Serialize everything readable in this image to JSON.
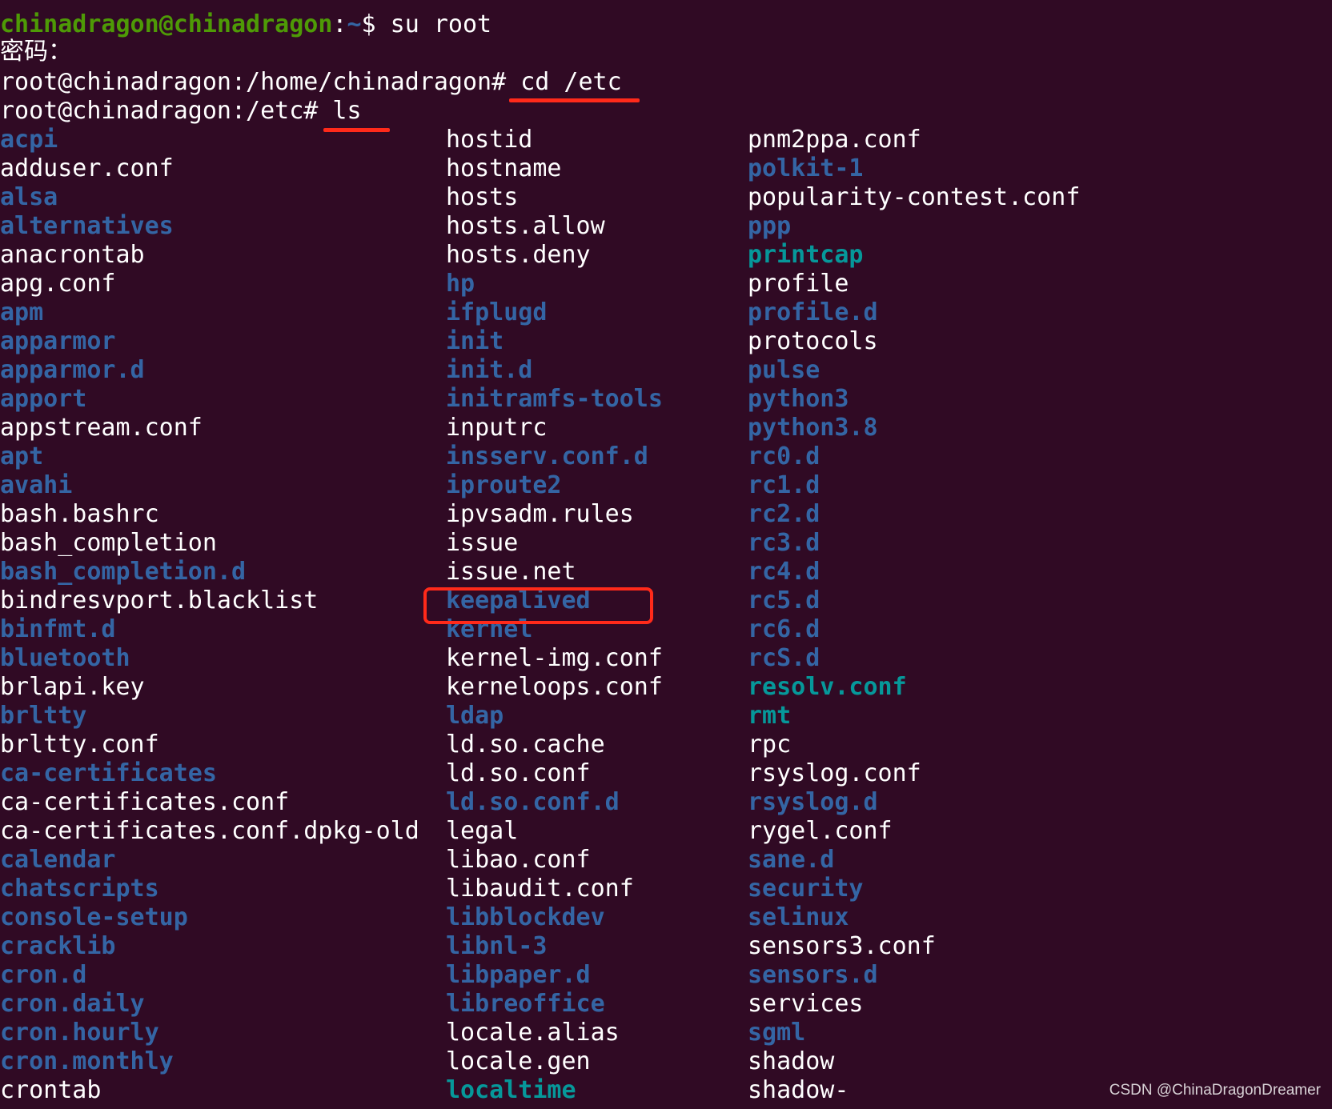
{
  "terminal": {
    "prompt1": {
      "userhost": "chinadragon@chinadragon",
      "colon": ":",
      "path": "~",
      "symbol": "$",
      "command": "su root"
    },
    "password_label": "密码：",
    "prompt2": {
      "prefix": "root@chinadragon:/home/chinadragon#",
      "command": "cd /etc"
    },
    "prompt3": {
      "prefix": "root@chinadragon:/etc#",
      "command": "ls"
    }
  },
  "colors": {
    "background": "#300a24",
    "directory": "#3465a4",
    "symlink": "#06989a",
    "file": "#ffffff",
    "user_prompt": "#4e9a06",
    "highlight": "#ff2a1a"
  },
  "listing": {
    "col1": [
      {
        "name": "acpi",
        "type": "dir"
      },
      {
        "name": "adduser.conf",
        "type": "file"
      },
      {
        "name": "alsa",
        "type": "dir"
      },
      {
        "name": "alternatives",
        "type": "dir"
      },
      {
        "name": "anacrontab",
        "type": "file"
      },
      {
        "name": "apg.conf",
        "type": "file"
      },
      {
        "name": "apm",
        "type": "dir"
      },
      {
        "name": "apparmor",
        "type": "dir"
      },
      {
        "name": "apparmor.d",
        "type": "dir"
      },
      {
        "name": "apport",
        "type": "dir"
      },
      {
        "name": "appstream.conf",
        "type": "file"
      },
      {
        "name": "apt",
        "type": "dir"
      },
      {
        "name": "avahi",
        "type": "dir"
      },
      {
        "name": "bash.bashrc",
        "type": "file"
      },
      {
        "name": "bash_completion",
        "type": "file"
      },
      {
        "name": "bash_completion.d",
        "type": "dir"
      },
      {
        "name": "bindresvport.blacklist",
        "type": "file"
      },
      {
        "name": "binfmt.d",
        "type": "dir"
      },
      {
        "name": "bluetooth",
        "type": "dir"
      },
      {
        "name": "brlapi.key",
        "type": "file"
      },
      {
        "name": "brltty",
        "type": "dir"
      },
      {
        "name": "brltty.conf",
        "type": "file"
      },
      {
        "name": "ca-certificates",
        "type": "dir"
      },
      {
        "name": "ca-certificates.conf",
        "type": "file"
      },
      {
        "name": "ca-certificates.conf.dpkg-old",
        "type": "file"
      },
      {
        "name": "calendar",
        "type": "dir"
      },
      {
        "name": "chatscripts",
        "type": "dir"
      },
      {
        "name": "console-setup",
        "type": "dir"
      },
      {
        "name": "cracklib",
        "type": "dir"
      },
      {
        "name": "cron.d",
        "type": "dir"
      },
      {
        "name": "cron.daily",
        "type": "dir"
      },
      {
        "name": "cron.hourly",
        "type": "dir"
      },
      {
        "name": "cron.monthly",
        "type": "dir"
      },
      {
        "name": "crontab",
        "type": "file"
      }
    ],
    "col2": [
      {
        "name": "hostid",
        "type": "file"
      },
      {
        "name": "hostname",
        "type": "file"
      },
      {
        "name": "hosts",
        "type": "file"
      },
      {
        "name": "hosts.allow",
        "type": "file"
      },
      {
        "name": "hosts.deny",
        "type": "file"
      },
      {
        "name": "hp",
        "type": "dir"
      },
      {
        "name": "ifplugd",
        "type": "dir"
      },
      {
        "name": "init",
        "type": "dir"
      },
      {
        "name": "init.d",
        "type": "dir"
      },
      {
        "name": "initramfs-tools",
        "type": "dir"
      },
      {
        "name": "inputrc",
        "type": "file"
      },
      {
        "name": "insserv.conf.d",
        "type": "dir"
      },
      {
        "name": "iproute2",
        "type": "dir"
      },
      {
        "name": "ipvsadm.rules",
        "type": "file"
      },
      {
        "name": "issue",
        "type": "file"
      },
      {
        "name": "issue.net",
        "type": "file"
      },
      {
        "name": "keepalived",
        "type": "dir"
      },
      {
        "name": "kernel",
        "type": "dir"
      },
      {
        "name": "kernel-img.conf",
        "type": "file"
      },
      {
        "name": "kerneloops.conf",
        "type": "file"
      },
      {
        "name": "ldap",
        "type": "dir"
      },
      {
        "name": "ld.so.cache",
        "type": "file"
      },
      {
        "name": "ld.so.conf",
        "type": "file"
      },
      {
        "name": "ld.so.conf.d",
        "type": "dir"
      },
      {
        "name": "legal",
        "type": "file"
      },
      {
        "name": "libao.conf",
        "type": "file"
      },
      {
        "name": "libaudit.conf",
        "type": "file"
      },
      {
        "name": "libblockdev",
        "type": "dir"
      },
      {
        "name": "libnl-3",
        "type": "dir"
      },
      {
        "name": "libpaper.d",
        "type": "dir"
      },
      {
        "name": "libreoffice",
        "type": "dir"
      },
      {
        "name": "locale.alias",
        "type": "file"
      },
      {
        "name": "locale.gen",
        "type": "file"
      },
      {
        "name": "localtime",
        "type": "link"
      }
    ],
    "col3": [
      {
        "name": "pnm2ppa.conf",
        "type": "file"
      },
      {
        "name": "polkit-1",
        "type": "dir"
      },
      {
        "name": "popularity-contest.conf",
        "type": "file"
      },
      {
        "name": "ppp",
        "type": "dir"
      },
      {
        "name": "printcap",
        "type": "link"
      },
      {
        "name": "profile",
        "type": "file"
      },
      {
        "name": "profile.d",
        "type": "dir"
      },
      {
        "name": "protocols",
        "type": "file"
      },
      {
        "name": "pulse",
        "type": "dir"
      },
      {
        "name": "python3",
        "type": "dir"
      },
      {
        "name": "python3.8",
        "type": "dir"
      },
      {
        "name": "rc0.d",
        "type": "dir"
      },
      {
        "name": "rc1.d",
        "type": "dir"
      },
      {
        "name": "rc2.d",
        "type": "dir"
      },
      {
        "name": "rc3.d",
        "type": "dir"
      },
      {
        "name": "rc4.d",
        "type": "dir"
      },
      {
        "name": "rc5.d",
        "type": "dir"
      },
      {
        "name": "rc6.d",
        "type": "dir"
      },
      {
        "name": "rcS.d",
        "type": "dir"
      },
      {
        "name": "resolv.conf",
        "type": "link"
      },
      {
        "name": "rmt",
        "type": "link"
      },
      {
        "name": "rpc",
        "type": "file"
      },
      {
        "name": "rsyslog.conf",
        "type": "file"
      },
      {
        "name": "rsyslog.d",
        "type": "dir"
      },
      {
        "name": "rygel.conf",
        "type": "file"
      },
      {
        "name": "sane.d",
        "type": "dir"
      },
      {
        "name": "security",
        "type": "dir"
      },
      {
        "name": "selinux",
        "type": "dir"
      },
      {
        "name": "sensors3.conf",
        "type": "file"
      },
      {
        "name": "sensors.d",
        "type": "dir"
      },
      {
        "name": "services",
        "type": "file"
      },
      {
        "name": "sgml",
        "type": "dir"
      },
      {
        "name": "shadow",
        "type": "file"
      },
      {
        "name": "shadow-",
        "type": "file"
      }
    ]
  },
  "watermark": "CSDN @ChinaDragonDreamer"
}
